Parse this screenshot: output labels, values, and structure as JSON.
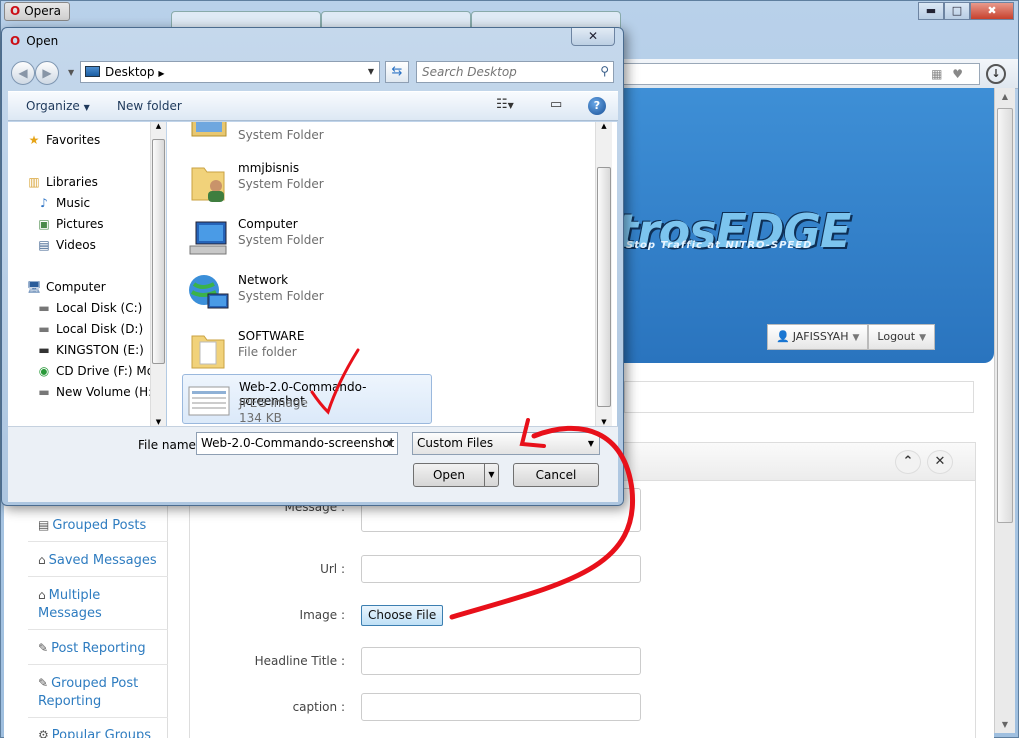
{
  "browser": {
    "menu_label": "Opera",
    "controls": {
      "minimize": "▬",
      "maximize": "□",
      "close": "✖"
    }
  },
  "site": {
    "logo_text": "trosEDGE",
    "logo_sub": "Stop Traffic at NITRO-SPEED",
    "user_label": "JAFISSYAH",
    "logout_label": "Logout",
    "sidebar": [
      {
        "icon": "list-icon",
        "label": "Grouped Posts"
      },
      {
        "icon": "home-icon",
        "label": "Saved Messages"
      },
      {
        "icon": "home-icon",
        "label": "Multiple Messages"
      },
      {
        "icon": "edit-icon",
        "label": "Post Reporting"
      },
      {
        "icon": "edit-icon",
        "label": "Grouped Post Reporting"
      },
      {
        "icon": "groups-icon",
        "label": "Popular Groups"
      }
    ],
    "form": {
      "message_label": "Message :",
      "url_label": "Url :",
      "image_label": "Image :",
      "choose_file_label": "Choose File",
      "headline_label": "Headline Title :",
      "caption_label": "caption :"
    }
  },
  "dialog": {
    "title": "Open",
    "breadcrumb": "Desktop",
    "search_placeholder": "Search Desktop",
    "toolbar": {
      "organize": "Organize",
      "new_folder": "New folder"
    },
    "nav": {
      "favorites": "Favorites",
      "libraries": "Libraries",
      "music": "Music",
      "pictures": "Pictures",
      "videos": "Videos",
      "computer": "Computer",
      "drives": [
        "Local Disk (C:)",
        "Local Disk (D:)",
        "KINGSTON (E:)",
        "CD Drive (F:) Mol",
        "New Volume (H:)"
      ]
    },
    "files": [
      {
        "name": "",
        "type": "System Folder"
      },
      {
        "name": "mmjbisnis",
        "type": "System Folder"
      },
      {
        "name": "Computer",
        "type": "System Folder"
      },
      {
        "name": "Network",
        "type": "System Folder"
      },
      {
        "name": "SOFTWARE",
        "type": "File folder"
      },
      {
        "name": "Web-2.0-Commando-screenshot",
        "type": "JPEG image",
        "size": "134 KB"
      }
    ],
    "file_name_label": "File name:",
    "file_name_value": "Web-2.0-Commando-screenshot",
    "file_type": "Custom Files",
    "open_label": "Open",
    "cancel_label": "Cancel"
  },
  "colors": {
    "accent": "#2e7cc0",
    "annotation": "#e8101a",
    "hero": "#3e8fd6"
  }
}
